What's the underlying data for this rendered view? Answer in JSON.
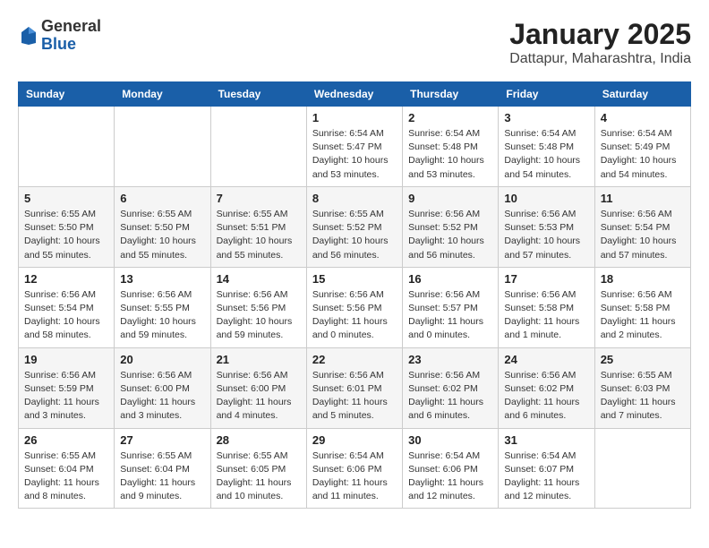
{
  "header": {
    "logo_general": "General",
    "logo_blue": "Blue",
    "month_title": "January 2025",
    "location": "Dattapur, Maharashtra, India"
  },
  "weekdays": [
    "Sunday",
    "Monday",
    "Tuesday",
    "Wednesday",
    "Thursday",
    "Friday",
    "Saturday"
  ],
  "weeks": [
    [
      {
        "day": "",
        "info": ""
      },
      {
        "day": "",
        "info": ""
      },
      {
        "day": "",
        "info": ""
      },
      {
        "day": "1",
        "info": "Sunrise: 6:54 AM\nSunset: 5:47 PM\nDaylight: 10 hours\nand 53 minutes."
      },
      {
        "day": "2",
        "info": "Sunrise: 6:54 AM\nSunset: 5:48 PM\nDaylight: 10 hours\nand 53 minutes."
      },
      {
        "day": "3",
        "info": "Sunrise: 6:54 AM\nSunset: 5:48 PM\nDaylight: 10 hours\nand 54 minutes."
      },
      {
        "day": "4",
        "info": "Sunrise: 6:54 AM\nSunset: 5:49 PM\nDaylight: 10 hours\nand 54 minutes."
      }
    ],
    [
      {
        "day": "5",
        "info": "Sunrise: 6:55 AM\nSunset: 5:50 PM\nDaylight: 10 hours\nand 55 minutes."
      },
      {
        "day": "6",
        "info": "Sunrise: 6:55 AM\nSunset: 5:50 PM\nDaylight: 10 hours\nand 55 minutes."
      },
      {
        "day": "7",
        "info": "Sunrise: 6:55 AM\nSunset: 5:51 PM\nDaylight: 10 hours\nand 55 minutes."
      },
      {
        "day": "8",
        "info": "Sunrise: 6:55 AM\nSunset: 5:52 PM\nDaylight: 10 hours\nand 56 minutes."
      },
      {
        "day": "9",
        "info": "Sunrise: 6:56 AM\nSunset: 5:52 PM\nDaylight: 10 hours\nand 56 minutes."
      },
      {
        "day": "10",
        "info": "Sunrise: 6:56 AM\nSunset: 5:53 PM\nDaylight: 10 hours\nand 57 minutes."
      },
      {
        "day": "11",
        "info": "Sunrise: 6:56 AM\nSunset: 5:54 PM\nDaylight: 10 hours\nand 57 minutes."
      }
    ],
    [
      {
        "day": "12",
        "info": "Sunrise: 6:56 AM\nSunset: 5:54 PM\nDaylight: 10 hours\nand 58 minutes."
      },
      {
        "day": "13",
        "info": "Sunrise: 6:56 AM\nSunset: 5:55 PM\nDaylight: 10 hours\nand 59 minutes."
      },
      {
        "day": "14",
        "info": "Sunrise: 6:56 AM\nSunset: 5:56 PM\nDaylight: 10 hours\nand 59 minutes."
      },
      {
        "day": "15",
        "info": "Sunrise: 6:56 AM\nSunset: 5:56 PM\nDaylight: 11 hours\nand 0 minutes."
      },
      {
        "day": "16",
        "info": "Sunrise: 6:56 AM\nSunset: 5:57 PM\nDaylight: 11 hours\nand 0 minutes."
      },
      {
        "day": "17",
        "info": "Sunrise: 6:56 AM\nSunset: 5:58 PM\nDaylight: 11 hours\nand 1 minute."
      },
      {
        "day": "18",
        "info": "Sunrise: 6:56 AM\nSunset: 5:58 PM\nDaylight: 11 hours\nand 2 minutes."
      }
    ],
    [
      {
        "day": "19",
        "info": "Sunrise: 6:56 AM\nSunset: 5:59 PM\nDaylight: 11 hours\nand 3 minutes."
      },
      {
        "day": "20",
        "info": "Sunrise: 6:56 AM\nSunset: 6:00 PM\nDaylight: 11 hours\nand 3 minutes."
      },
      {
        "day": "21",
        "info": "Sunrise: 6:56 AM\nSunset: 6:00 PM\nDaylight: 11 hours\nand 4 minutes."
      },
      {
        "day": "22",
        "info": "Sunrise: 6:56 AM\nSunset: 6:01 PM\nDaylight: 11 hours\nand 5 minutes."
      },
      {
        "day": "23",
        "info": "Sunrise: 6:56 AM\nSunset: 6:02 PM\nDaylight: 11 hours\nand 6 minutes."
      },
      {
        "day": "24",
        "info": "Sunrise: 6:56 AM\nSunset: 6:02 PM\nDaylight: 11 hours\nand 6 minutes."
      },
      {
        "day": "25",
        "info": "Sunrise: 6:55 AM\nSunset: 6:03 PM\nDaylight: 11 hours\nand 7 minutes."
      }
    ],
    [
      {
        "day": "26",
        "info": "Sunrise: 6:55 AM\nSunset: 6:04 PM\nDaylight: 11 hours\nand 8 minutes."
      },
      {
        "day": "27",
        "info": "Sunrise: 6:55 AM\nSunset: 6:04 PM\nDaylight: 11 hours\nand 9 minutes."
      },
      {
        "day": "28",
        "info": "Sunrise: 6:55 AM\nSunset: 6:05 PM\nDaylight: 11 hours\nand 10 minutes."
      },
      {
        "day": "29",
        "info": "Sunrise: 6:54 AM\nSunset: 6:06 PM\nDaylight: 11 hours\nand 11 minutes."
      },
      {
        "day": "30",
        "info": "Sunrise: 6:54 AM\nSunset: 6:06 PM\nDaylight: 11 hours\nand 12 minutes."
      },
      {
        "day": "31",
        "info": "Sunrise: 6:54 AM\nSunset: 6:07 PM\nDaylight: 11 hours\nand 12 minutes."
      },
      {
        "day": "",
        "info": ""
      }
    ]
  ]
}
